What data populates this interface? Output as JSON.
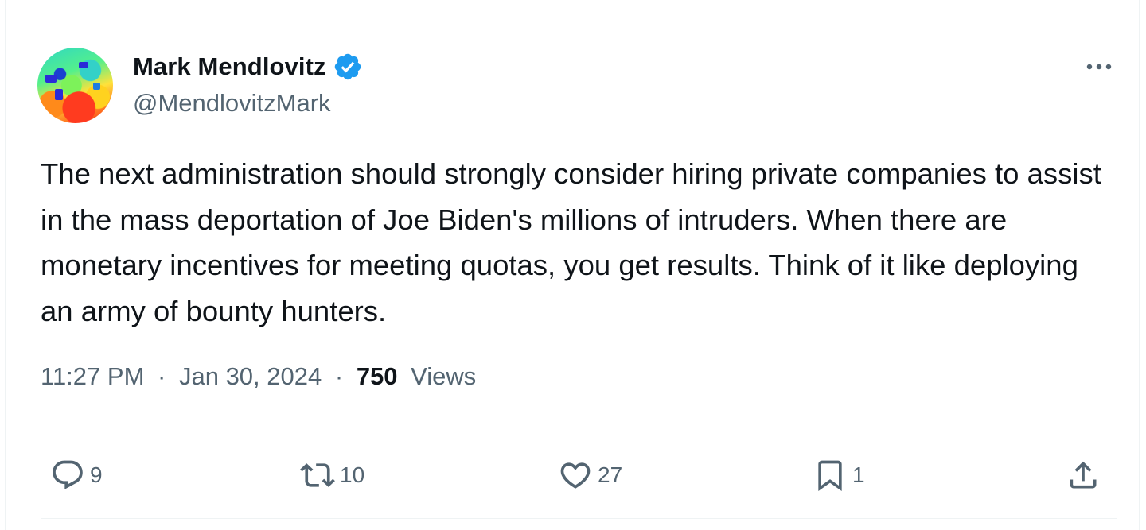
{
  "author": {
    "display_name": "Mark Mendlovitz",
    "handle": "@MendlovitzMark",
    "verified": true,
    "verified_color": "#1d9bf0"
  },
  "tweet": {
    "text": "The next administration should strongly consider hiring private companies to assist in the mass deportation of Joe Biden's millions of intruders. When there are monetary incentives for meeting quotas, you get results. Think of it like deploying an army of bounty hunters.",
    "time": "11:27 PM",
    "separator": "·",
    "date": "Jan 30, 2024",
    "views_count": "750",
    "views_label": "Views"
  },
  "actions": {
    "reply": {
      "icon": "reply-icon",
      "count": "9"
    },
    "repost": {
      "icon": "repost-icon",
      "count": "10"
    },
    "like": {
      "icon": "heart-icon",
      "count": "27"
    },
    "bookmark": {
      "icon": "bookmark-icon",
      "count": "1"
    },
    "share": {
      "icon": "share-icon"
    }
  },
  "menu": {
    "icon": "more-icon"
  },
  "colors": {
    "text_primary": "#0f1419",
    "text_secondary": "#536471",
    "divider": "#eff3f4"
  }
}
